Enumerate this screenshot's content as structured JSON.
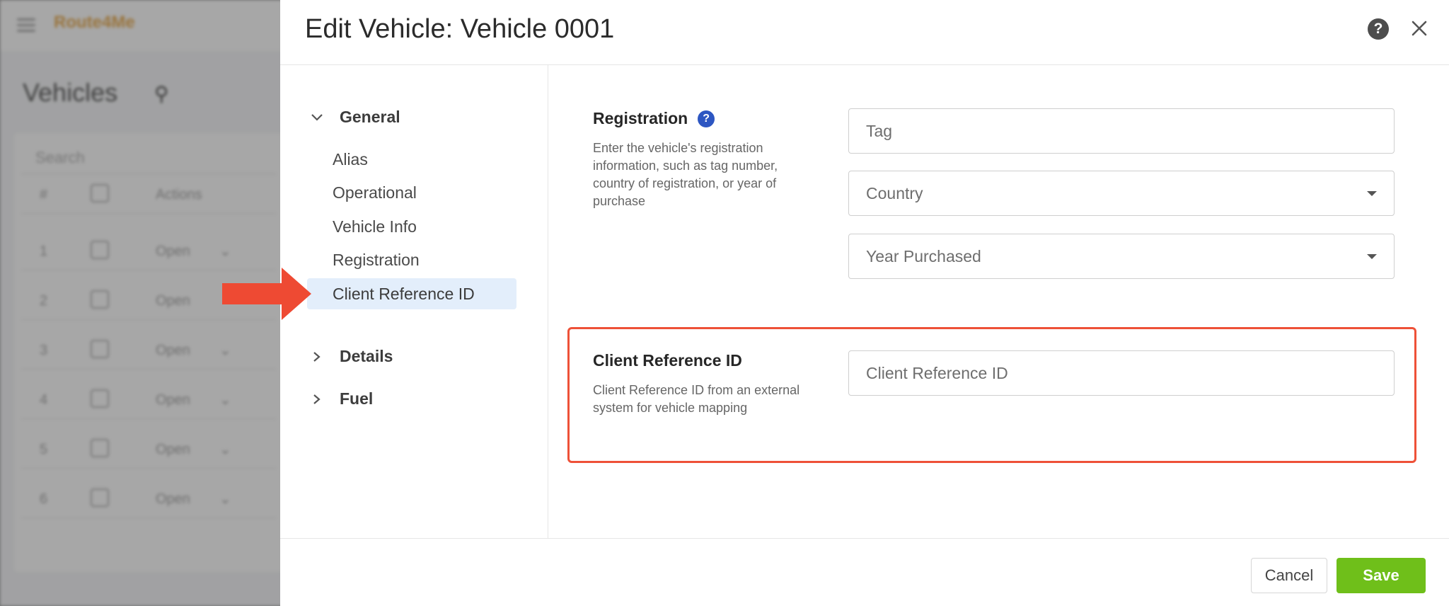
{
  "background": {
    "logo": "Route4Me",
    "page_title": "Vehicles",
    "search_placeholder": "Search",
    "table_headers": [
      "#",
      "Actions"
    ],
    "rows": [
      {
        "n": "1",
        "status": "Open"
      },
      {
        "n": "2",
        "status": "Open"
      },
      {
        "n": "3",
        "status": "Open"
      },
      {
        "n": "4",
        "status": "Open"
      },
      {
        "n": "5",
        "status": "Open"
      },
      {
        "n": "6",
        "status": "Open"
      }
    ]
  },
  "modal": {
    "title": "Edit Vehicle: Vehicle 0001",
    "help_icon": "question-circle-icon",
    "close_icon": "close-icon"
  },
  "nav": {
    "groups": [
      {
        "label": "General",
        "expanded": true
      },
      {
        "label": "Details",
        "expanded": false
      },
      {
        "label": "Fuel",
        "expanded": false
      }
    ],
    "general_items": [
      "Alias",
      "Operational",
      "Vehicle Info",
      "Registration",
      "Client Reference ID"
    ],
    "active_item": "Client Reference ID"
  },
  "registration": {
    "title": "Registration",
    "description": "Enter the vehicle's registration information, such as tag number, country of registration, or year of purchase",
    "tag_placeholder": "Tag",
    "country_placeholder": "Country",
    "year_placeholder": "Year Purchased"
  },
  "client_reference": {
    "title": "Client Reference ID",
    "description": "Client Reference ID from an external system for vehicle mapping",
    "placeholder": "Client Reference ID"
  },
  "footer": {
    "cancel_label": "Cancel",
    "save_label": "Save"
  },
  "colors": {
    "accent_save": "#6fbf1a",
    "highlight": "#ee5138",
    "info_badge": "#2d56c2",
    "active_nav": "#e3eefb"
  }
}
